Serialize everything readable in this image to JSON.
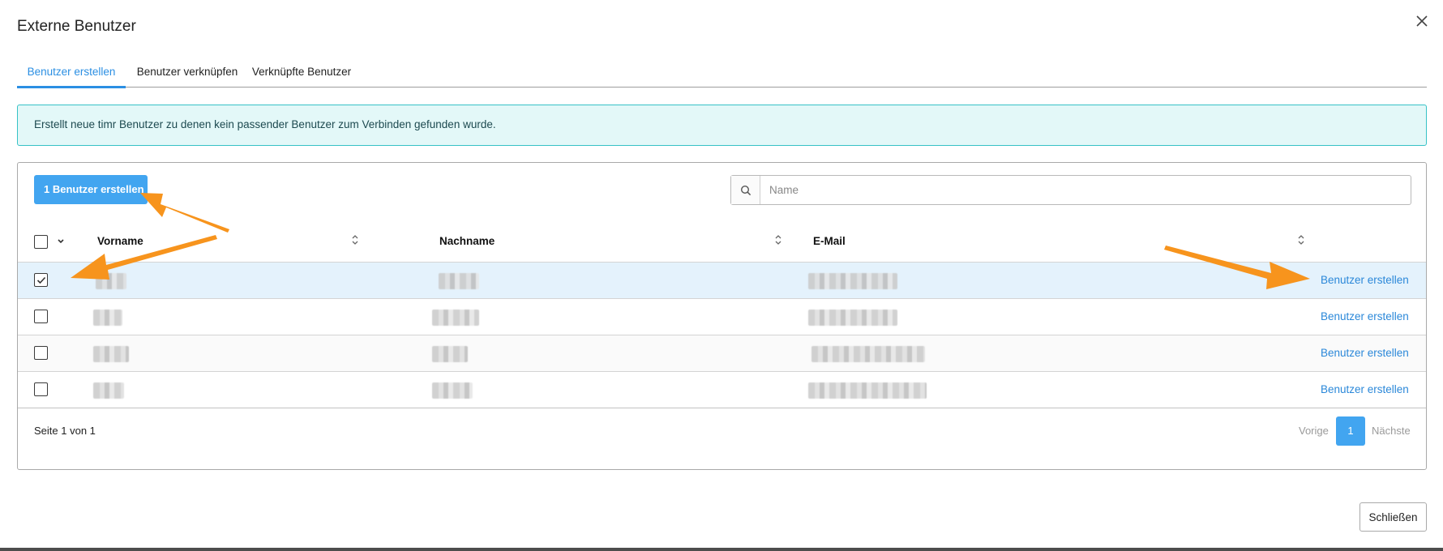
{
  "dialog": {
    "title": "Externe Benutzer",
    "close_icon": "close-icon"
  },
  "tabs": [
    {
      "label": "Benutzer erstellen",
      "active": true
    },
    {
      "label": "Benutzer verknüpfen",
      "active": false
    },
    {
      "label": "Verknüpfte Benutzer",
      "active": false
    }
  ],
  "info": {
    "text": "Erstellt neue timr Benutzer zu denen kein passender Benutzer zum Verbinden gefunden wurde."
  },
  "toolbar": {
    "create_button_label": "1 Benutzer erstellen",
    "search_icon": "search-icon",
    "search_placeholder": "Name",
    "search_value": ""
  },
  "table": {
    "columns": [
      "Vorname",
      "Nachname",
      "E-Mail"
    ],
    "rows": [
      {
        "checked": true,
        "action": "Benutzer erstellen"
      },
      {
        "checked": false,
        "action": "Benutzer erstellen"
      },
      {
        "checked": false,
        "action": "Benutzer erstellen"
      },
      {
        "checked": false,
        "action": "Benutzer erstellen"
      }
    ]
  },
  "pagination": {
    "summary": "Seite 1 von 1",
    "prev_label": "Vorige",
    "current_page": "1",
    "next_label": "Nächste"
  },
  "footer": {
    "close_label": "Schließen"
  },
  "colors": {
    "accent": "#42a5f0",
    "link": "#2b88d9",
    "info_bg": "#e3f8f8",
    "info_border": "#37c2c6",
    "annotation_arrow": "#f7941d"
  }
}
